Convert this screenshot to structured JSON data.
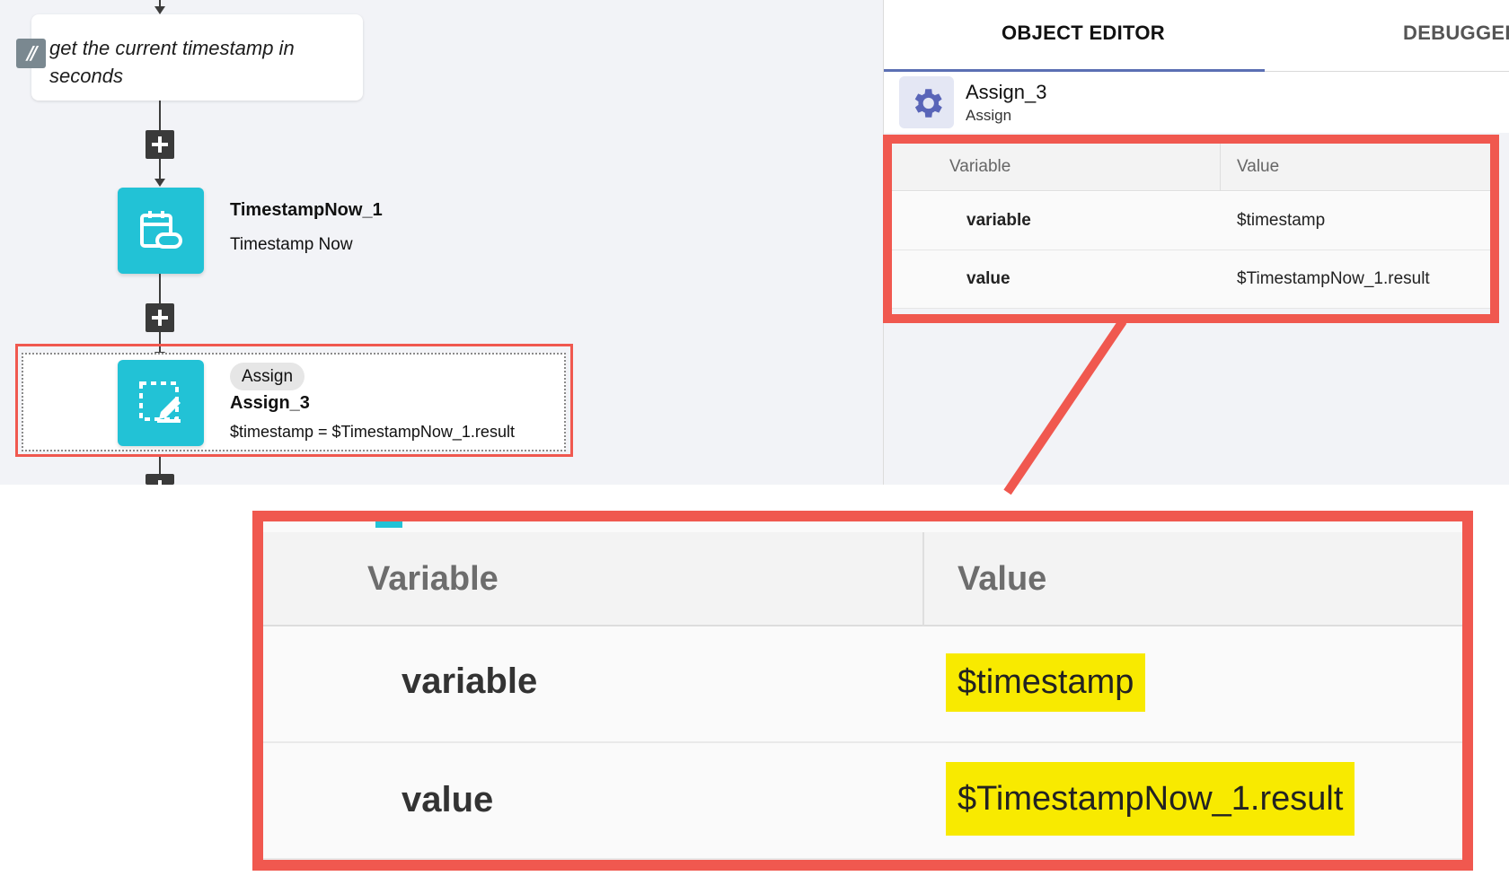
{
  "flow": {
    "comment": "get the current timestamp in seconds",
    "comment_icon": "//",
    "node1": {
      "title": "TimestampNow_1",
      "subtitle": "Timestamp Now",
      "icon": "calendar-edit-icon"
    },
    "node2": {
      "badge": "Assign",
      "title": "Assign_3",
      "subtitle": "$timestamp = $TimestampNow_1.result",
      "icon": "select-edit-icon"
    }
  },
  "panel": {
    "tabs": [
      "OBJECT EDITOR",
      "DEBUGGER"
    ],
    "object": {
      "name": "Assign_3",
      "type": "Assign",
      "icon": "gear-icon"
    },
    "table": {
      "columns": [
        "Variable",
        "Value"
      ],
      "rows": [
        {
          "key": "variable",
          "value": "$timestamp"
        },
        {
          "key": "value",
          "value": "$TimestampNow_1.result"
        }
      ]
    }
  },
  "zoom": {
    "columns": [
      "Variable",
      "Value"
    ],
    "rows": [
      {
        "key": "variable",
        "value": "$timestamp"
      },
      {
        "key": "value",
        "value": "$TimestampNow_1.result"
      }
    ]
  },
  "colors": {
    "accent": "#22c2d6",
    "callout": "#f0584f",
    "highlight": "#f8ea00",
    "tab_underline": "#5b6fb3"
  }
}
